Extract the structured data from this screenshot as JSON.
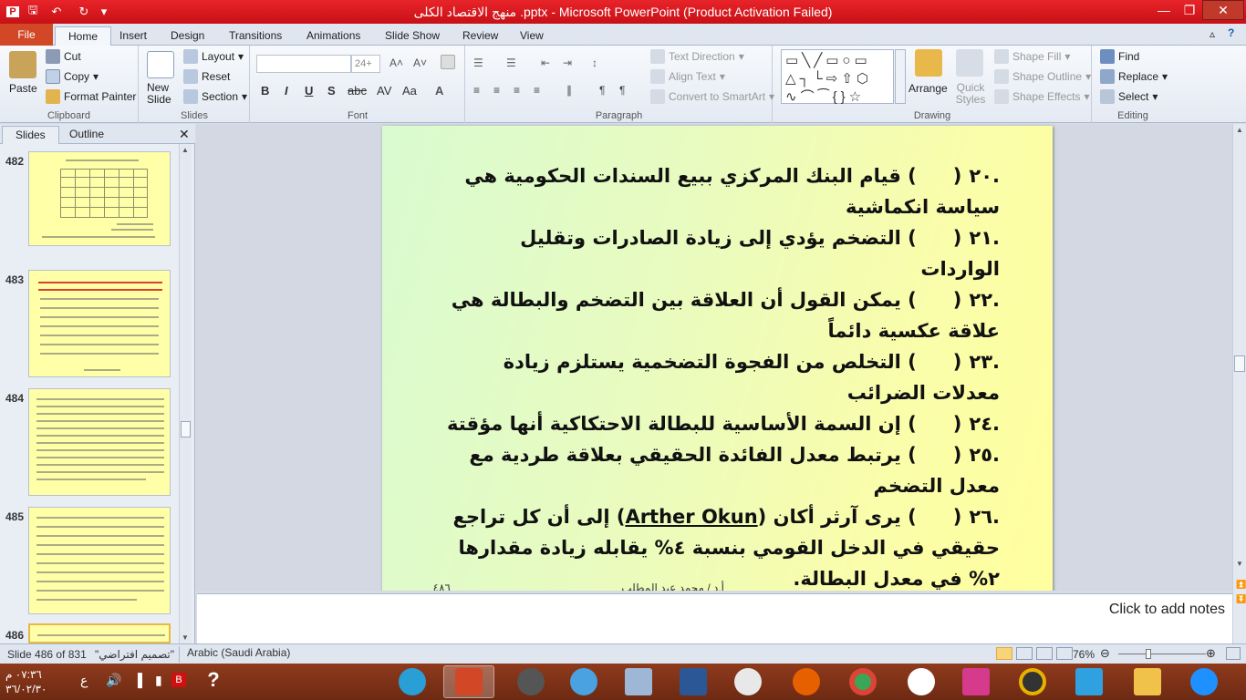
{
  "window": {
    "title": "منهج الاقتصاد الكلى .pptx - Microsoft PowerPoint (Product Activation Failed)",
    "minimize": "—",
    "restore": "❐",
    "close": "✕"
  },
  "tabs": [
    "File",
    "Home",
    "Insert",
    "Design",
    "Transitions",
    "Animations",
    "Slide Show",
    "Review",
    "View"
  ],
  "ribbon": {
    "clipboard": {
      "paste": "Paste",
      "cut": "Cut",
      "copy": "Copy",
      "format_painter": "Format Painter",
      "label": "Clipboard"
    },
    "slides": {
      "new_slide": "New Slide",
      "layout": "Layout",
      "reset": "Reset",
      "section": "Section",
      "label": "Slides"
    },
    "font": {
      "size": "24+",
      "label": "Font"
    },
    "paragraph": {
      "text_direction": "Text Direction",
      "align_text": "Align Text",
      "smartart": "Convert to SmartArt",
      "label": "Paragraph"
    },
    "drawing": {
      "arrange": "Arrange",
      "quick_styles": "Quick Styles",
      "shape_fill": "Shape Fill",
      "shape_outline": "Shape Outline",
      "shape_effects": "Shape Effects",
      "label": "Drawing"
    },
    "editing": {
      "find": "Find",
      "replace": "Replace",
      "select": "Select",
      "label": "Editing"
    }
  },
  "left_pane": {
    "tab_slides": "Slides",
    "tab_outline": "Outline",
    "thumbnails": [
      "482",
      "483",
      "484",
      "485",
      "486"
    ]
  },
  "slide": {
    "items": [
      {
        "num": ".٢٠",
        "text": ") قيام البنك المركزي ببيع السندات الحكومية هي سياسة انكماشية"
      },
      {
        "num": ".٢١",
        "text": ") التضخم يؤدي إلى زيادة الصادرات وتقليل الواردات"
      },
      {
        "num": ".٢٢",
        "text": ") يمكن القول أن العلاقة بين التضخم والبطالة هي علاقة عكسية دائماً"
      },
      {
        "num": ".٢٣",
        "text": ") التخلص من الفجوة التضخمية يستلزم زيادة معدلات الضرائب"
      },
      {
        "num": ".٢٤",
        "text": ") إن السمة الأساسية للبطالة الاحتكاكية أنها مؤقتة"
      },
      {
        "num": ".٢٥",
        "text": ") يرتبط معدل الفائدة الحقيقي بعلاقة طردية مع معدل التضخم"
      }
    ],
    "item26": {
      "num": ".٢٦",
      "before": ") يرى آرثر أكان (",
      "name": "Arther Okun",
      "after": ") إلى أن كل تراجع حقيقي في الدخل القومي بنسبة ٤% يقابله زيادة مقدارها ٢% في معدل البطالة."
    },
    "footer_page": "٤٨٦",
    "footer_author": "أ.د / محمد عبد المطلب"
  },
  "notes": {
    "placeholder": "Click to add notes"
  },
  "status": {
    "slide": "Slide 486 of 831",
    "theme": "\"تصميم افتراضي\"",
    "language": "Arabic (Saudi Arabia)",
    "zoom": "76%"
  },
  "taskbar": {
    "time": "٠٧:٣٦ م",
    "date": "٣٦/٠٢/٣٠",
    "lang": "ع"
  },
  "colors": {
    "titlebar": "#d6141b",
    "file_tab": "#d24726",
    "slide_bg": "#ffffa8",
    "taskbar": "#7a2f16"
  }
}
